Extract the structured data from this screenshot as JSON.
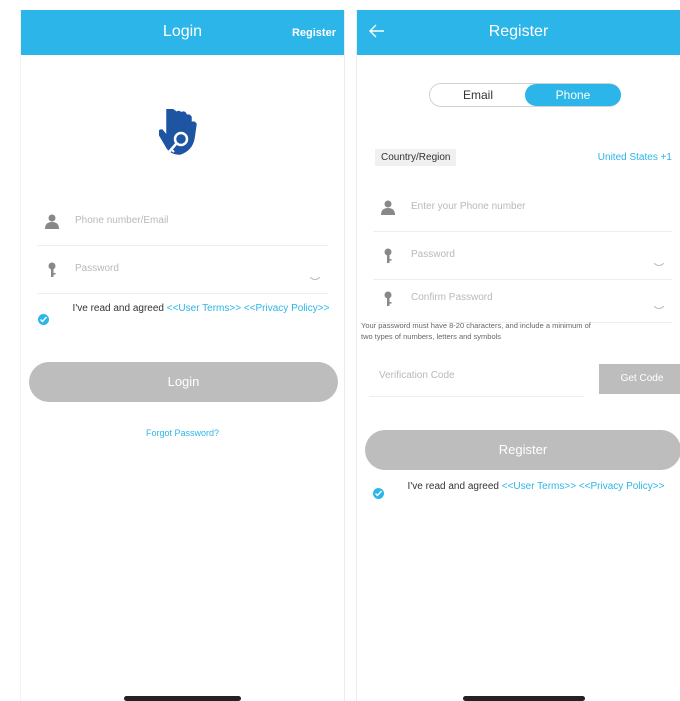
{
  "colors": {
    "accent": "#2cb5e8",
    "button_disabled": "#bdbdbd",
    "placeholder": "#b9b9b9"
  },
  "login": {
    "title": "Login",
    "register_link": "Register",
    "icon": "hand-key-icon",
    "fields": {
      "account_placeholder": "Phone number/Email",
      "password_placeholder": "Password"
    },
    "agree": {
      "text": "I've read and agreed",
      "user_terms": "<<User Terms>>",
      "privacy": "<<Privacy Policy>>"
    },
    "login_button": "Login",
    "forgot_password": "Forgot Password?"
  },
  "register": {
    "title": "Register",
    "back_icon": "arrow-left-icon",
    "tabs": {
      "email": "Email",
      "phone": "Phone",
      "selected": "Phone"
    },
    "country_label": "Country/Region",
    "country_value": "United States +1",
    "fields": {
      "phone_placeholder": "Enter your Phone number",
      "password_placeholder": "Password",
      "confirm_placeholder": "Confirm Password"
    },
    "password_hint_line1": "Your password must have 8-20 characters, and include a minimum of",
    "password_hint_line2": "two types of numbers, letters and symbols",
    "verification_placeholder": "Verification Code",
    "get_code_button": "Get Code",
    "register_button": "Register",
    "agree": {
      "text": "I've read and agreed",
      "user_terms": "<<User Terms>>",
      "privacy": "<<Privacy Policy>>"
    }
  }
}
